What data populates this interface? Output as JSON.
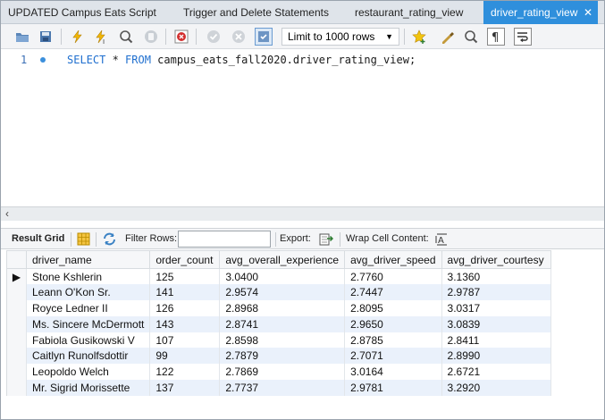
{
  "tabs": [
    {
      "label": "UPDATED Campus Eats Script",
      "active": false
    },
    {
      "label": "Trigger and Delete Statements",
      "active": false
    },
    {
      "label": "restaurant_rating_view",
      "active": false
    },
    {
      "label": "driver_rating_view",
      "active": true,
      "close": "✕"
    }
  ],
  "toolbar": {
    "limit_label": "Limit to 1000 rows",
    "icons": [
      "open-folder-icon",
      "save-icon",
      "execute-icon",
      "execute-current-icon",
      "explain-icon",
      "stop-icon",
      "toggle-error-icon",
      "commit-icon",
      "rollback-icon",
      "autocommit-icon",
      "add-snippet-icon",
      "beautify-icon",
      "find-icon",
      "invisible-chars-icon",
      "word-wrap-icon"
    ]
  },
  "editor": {
    "line_number": "1",
    "kw1": "SELECT",
    "mid": " * ",
    "kw2": "FROM",
    "rest": " campus_eats_fall2020.driver_rating_view;"
  },
  "scroll_arrow": "‹",
  "result_bar": {
    "grid_label": "Result Grid",
    "filter_label": "Filter Rows:",
    "filter_value": "",
    "export_label": "Export:",
    "wrap_label": "Wrap Cell Content:"
  },
  "grid": {
    "columns": [
      "driver_name",
      "order_count",
      "avg_overall_experience",
      "avg_driver_speed",
      "avg_driver_courtesy"
    ],
    "current_row_marker": "▶",
    "rows": [
      [
        "Stone Kshlerin",
        "125",
        "3.0400",
        "2.7760",
        "3.1360"
      ],
      [
        "Leann O'Kon Sr.",
        "141",
        "2.9574",
        "2.7447",
        "2.9787"
      ],
      [
        "Royce Ledner II",
        "126",
        "2.8968",
        "2.8095",
        "3.0317"
      ],
      [
        "Ms. Sincere McDermott",
        "143",
        "2.8741",
        "2.9650",
        "3.0839"
      ],
      [
        "Fabiola Gusikowski V",
        "107",
        "2.8598",
        "2.8785",
        "2.8411"
      ],
      [
        "Caitlyn Runolfsdottir",
        "99",
        "2.7879",
        "2.7071",
        "2.8990"
      ],
      [
        "Leopoldo Welch",
        "122",
        "2.7869",
        "3.0164",
        "2.6721"
      ],
      [
        "Mr. Sigrid Morissette",
        "137",
        "2.7737",
        "2.9781",
        "3.2920"
      ]
    ]
  },
  "colors": {
    "active_tab": "#2f8fdc",
    "keyword": "#1f6fcf",
    "alt_row": "#eaf1fb"
  }
}
